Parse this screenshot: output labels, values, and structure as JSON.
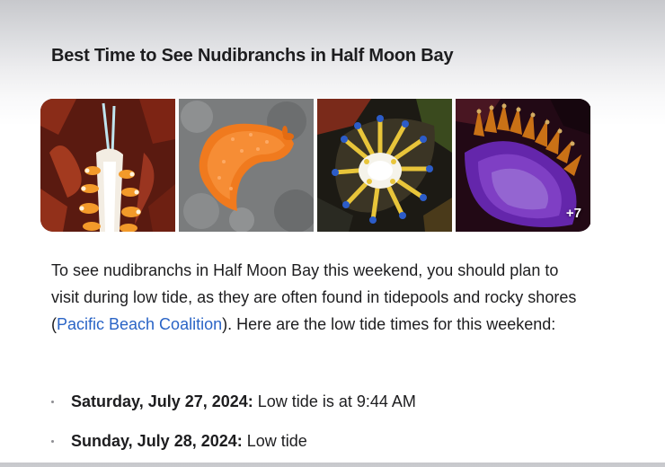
{
  "heading": "Best Time to See Nudibranchs in Half Moon Bay",
  "gallery": {
    "images": [
      {
        "icon": "nudibranch-photo-orange-white"
      },
      {
        "icon": "nudibranch-photo-orange-sea-lemon"
      },
      {
        "icon": "nudibranch-photo-yellow-blue-tipped"
      },
      {
        "icon": "nudibranch-photo-purple-orange"
      }
    ],
    "more_count": "+7"
  },
  "paragraph": {
    "before_link": "To see nudibranchs in Half Moon Bay this weekend, you should plan to visit during low tide, as they are often found in tidepools and rocky shores (",
    "link_text": "Pacific Beach Coalition",
    "after_link": "). Here are the low tide times for this weekend:"
  },
  "tides": [
    {
      "date": "Saturday, July 27, 2024:",
      "text": " Low tide is at 9:44 AM"
    },
    {
      "date": "Sunday, July 28, 2024:",
      "text": " Low tide"
    }
  ],
  "colors": {
    "link": "#2a64c6",
    "text": "#1d1d1f"
  }
}
